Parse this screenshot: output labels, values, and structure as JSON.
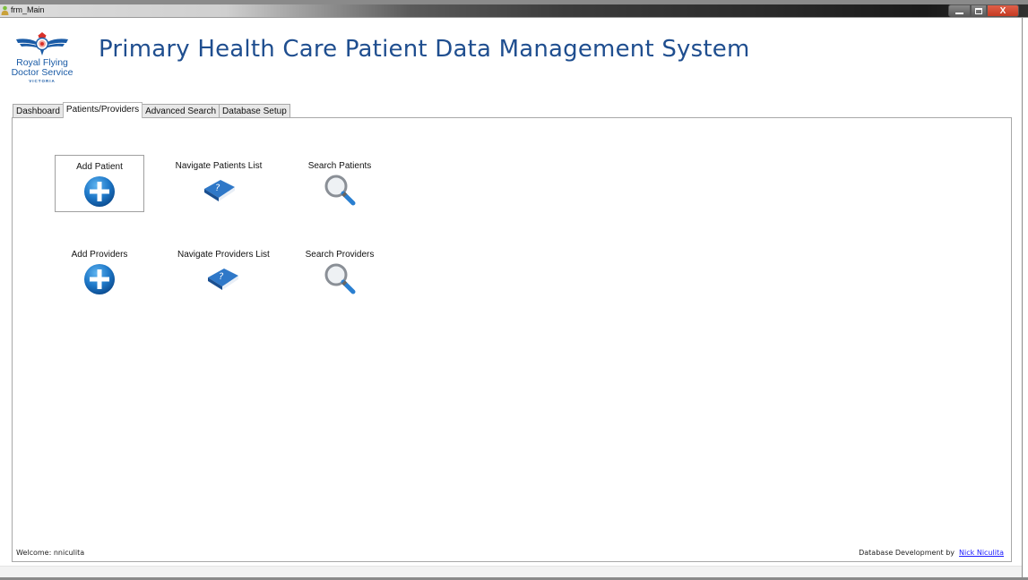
{
  "window": {
    "title": "frm_Main",
    "controls": {
      "minimize": "minimize",
      "maximize": "maximize",
      "close": "X"
    }
  },
  "header": {
    "logo": {
      "line1": "Royal Flying",
      "line2": "Doctor Service",
      "line3": "VICTORIA"
    },
    "title": "Primary Health Care Patient Data Management System"
  },
  "tabs": [
    {
      "label": "Dashboard",
      "active": false
    },
    {
      "label": "Patients/Providers",
      "active": true
    },
    {
      "label": "Advanced Search",
      "active": false
    },
    {
      "label": "Database Setup",
      "active": false
    }
  ],
  "actions": {
    "patients": [
      {
        "label": "Add Patient",
        "icon": "add-circle-icon"
      },
      {
        "label": "Navigate Patients List",
        "icon": "help-book-icon"
      },
      {
        "label": "Search Patients",
        "icon": "magnifier-icon"
      }
    ],
    "providers": [
      {
        "label": "Add Providers",
        "icon": "add-circle-icon"
      },
      {
        "label": "Navigate Providers List",
        "icon": "help-book-icon"
      },
      {
        "label": "Search Providers",
        "icon": "magnifier-icon"
      }
    ]
  },
  "footer": {
    "welcome": "Welcome: nniculita",
    "credit_prefix": "Database Development by",
    "credit_link": "Nick Niculita"
  },
  "colors": {
    "title_blue": "#1f4e8f",
    "logo_blue": "#1a5ba6",
    "icon_blue": "#1e78c8",
    "close_red": "#c43a22",
    "link_blue": "#1a1aff"
  }
}
